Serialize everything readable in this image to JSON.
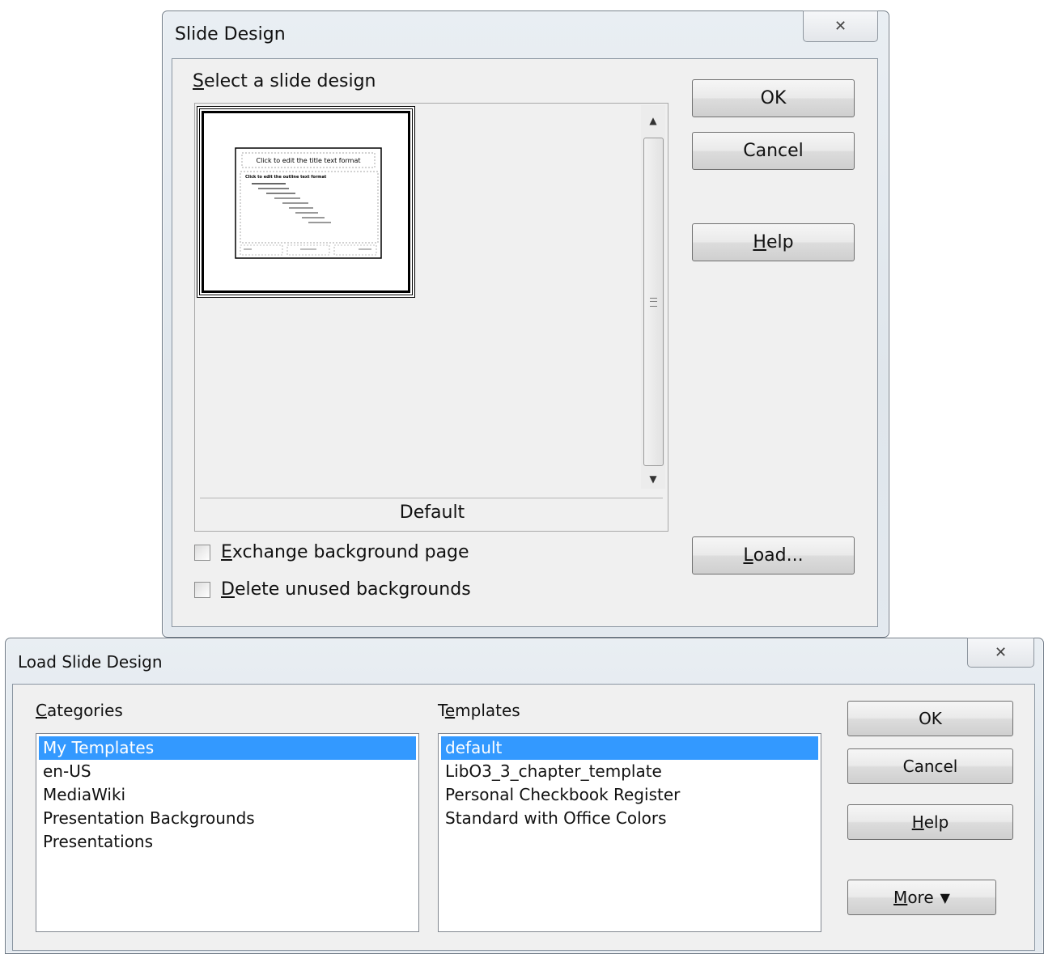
{
  "slide_design": {
    "title": "Slide Design",
    "select_label_accel": "S",
    "select_label_rest": "elect a slide design",
    "preview": {
      "thumbnail_title": "Click to edit the title text format",
      "thumbnail_outline": "Click to edit the outline text format",
      "design_name": "Default"
    },
    "buttons": {
      "ok": "OK",
      "cancel": "Cancel",
      "help_accel": "H",
      "help_rest": "elp",
      "load_accel": "L",
      "load_rest": "oad..."
    },
    "checkboxes": {
      "exchange_accel": "E",
      "exchange_rest": "xchange background page",
      "exchange_checked": false,
      "delete_accel": "D",
      "delete_rest": "elete unused backgrounds",
      "delete_checked": false
    }
  },
  "load_slide_design": {
    "title": "Load Slide Design",
    "categories_label_accel": "C",
    "categories_label_rest": "ategories",
    "templates_label_first": "T",
    "templates_label_accel": "e",
    "templates_label_rest": "mplates",
    "categories": [
      "My Templates",
      "en-US",
      "MediaWiki",
      "Presentation Backgrounds",
      "Presentations"
    ],
    "selected_category": 0,
    "templates": [
      "default",
      "LibO3_3_chapter_template",
      "Personal Checkbook Register",
      "Standard with Office Colors"
    ],
    "selected_template": 0,
    "buttons": {
      "ok": "OK",
      "cancel": "Cancel",
      "help_accel": "H",
      "help_rest": "elp",
      "more_accel": "M",
      "more_rest": "ore"
    }
  },
  "icons": {
    "close": "close-icon",
    "scroll_up": "arrow-up-icon",
    "scroll_down": "arrow-down-icon",
    "more": "double-chevron-down-icon"
  },
  "colors": {
    "selection": "#3399ff",
    "dialog_bg": "#f0f0f0"
  }
}
